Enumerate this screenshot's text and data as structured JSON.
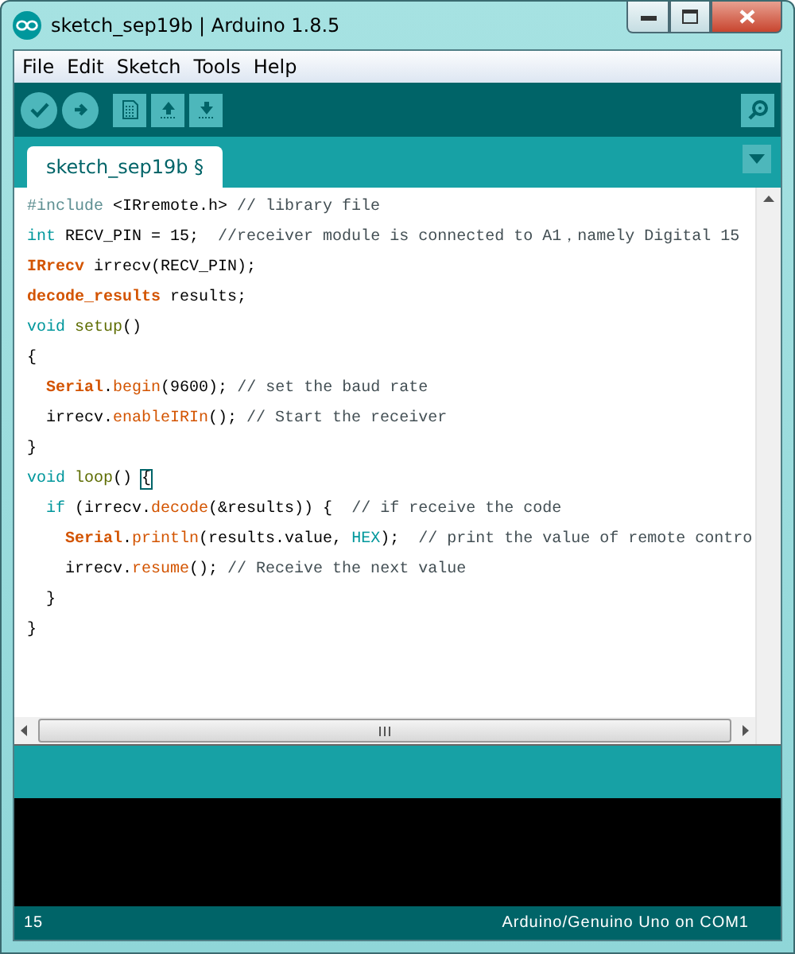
{
  "window": {
    "title": "sketch_sep19b | Arduino 1.8.5"
  },
  "menu": [
    "File",
    "Edit",
    "Sketch",
    "Tools",
    "Help"
  ],
  "tabs": [
    {
      "label": "sketch_sep19b §",
      "selected": true
    }
  ],
  "code": [
    {
      "tokens": [
        {
          "kind": "preproc",
          "text": "#include "
        },
        {
          "kind": "plain",
          "text": "<IRremote.h>"
        },
        {
          "kind": "comment",
          "text": " // library file"
        }
      ]
    },
    {
      "tokens": [
        {
          "kind": "keyword",
          "text": "int"
        },
        {
          "kind": "plain",
          "text": " RECV_PIN = 15;  "
        },
        {
          "kind": "comment",
          "text": "//receiver module is connected to A1，namely Digital 15"
        }
      ]
    },
    {
      "tokens": [
        {
          "kind": "type",
          "text": "IRrecv"
        },
        {
          "kind": "plain",
          "text": " irrecv(RECV_PIN);"
        }
      ]
    },
    {
      "tokens": [
        {
          "kind": "type",
          "text": "decode_results"
        },
        {
          "kind": "plain",
          "text": " results;"
        }
      ]
    },
    {
      "tokens": [
        {
          "kind": "keyword",
          "text": "void "
        },
        {
          "kind": "function",
          "text": "setup"
        },
        {
          "kind": "plain",
          "text": "()"
        }
      ]
    },
    {
      "tokens": [
        {
          "kind": "plain",
          "text": "{"
        }
      ]
    },
    {
      "tokens": [
        {
          "kind": "type",
          "text": "  Serial"
        },
        {
          "kind": "plain",
          "text": "."
        },
        {
          "kind": "method",
          "text": "begin"
        },
        {
          "kind": "plain",
          "text": "(9600); "
        },
        {
          "kind": "comment",
          "text": "// set the baud rate"
        }
      ]
    },
    {
      "tokens": [
        {
          "kind": "plain",
          "text": "  irrecv."
        },
        {
          "kind": "method",
          "text": "enableIRIn"
        },
        {
          "kind": "plain",
          "text": "(); "
        },
        {
          "kind": "comment",
          "text": "// Start the receiver"
        }
      ]
    },
    {
      "tokens": [
        {
          "kind": "plain",
          "text": "}"
        }
      ]
    },
    {
      "tokens": [
        {
          "kind": "keyword",
          "text": "void "
        },
        {
          "kind": "function",
          "text": "loop"
        },
        {
          "kind": "plain",
          "text": "() "
        },
        {
          "kind": "bracket-match",
          "text": "{"
        }
      ]
    },
    {
      "tokens": [
        {
          "kind": "keyword",
          "text": "  if"
        },
        {
          "kind": "plain",
          "text": " (irrecv."
        },
        {
          "kind": "method",
          "text": "decode"
        },
        {
          "kind": "plain",
          "text": "(&results)) {  "
        },
        {
          "kind": "comment",
          "text": "// if receive the code"
        }
      ]
    },
    {
      "tokens": [
        {
          "kind": "type",
          "text": "    Serial"
        },
        {
          "kind": "plain",
          "text": "."
        },
        {
          "kind": "method",
          "text": "println"
        },
        {
          "kind": "plain",
          "text": "(results.value, "
        },
        {
          "kind": "keyword",
          "text": "HEX"
        },
        {
          "kind": "plain",
          "text": ");  "
        },
        {
          "kind": "comment",
          "text": "// print the value of remote contro"
        }
      ]
    },
    {
      "tokens": [
        {
          "kind": "plain",
          "text": "    irrecv."
        },
        {
          "kind": "method",
          "text": "resume"
        },
        {
          "kind": "plain",
          "text": "(); "
        },
        {
          "kind": "comment",
          "text": "// Receive the next value"
        }
      ]
    },
    {
      "tokens": [
        {
          "kind": "plain",
          "text": "  }"
        }
      ]
    },
    {
      "tokens": [
        {
          "kind": "plain",
          "text": "}"
        }
      ]
    }
  ],
  "status_bar": {
    "line": "15",
    "board": "Arduino/Genuino Uno on COM1"
  }
}
